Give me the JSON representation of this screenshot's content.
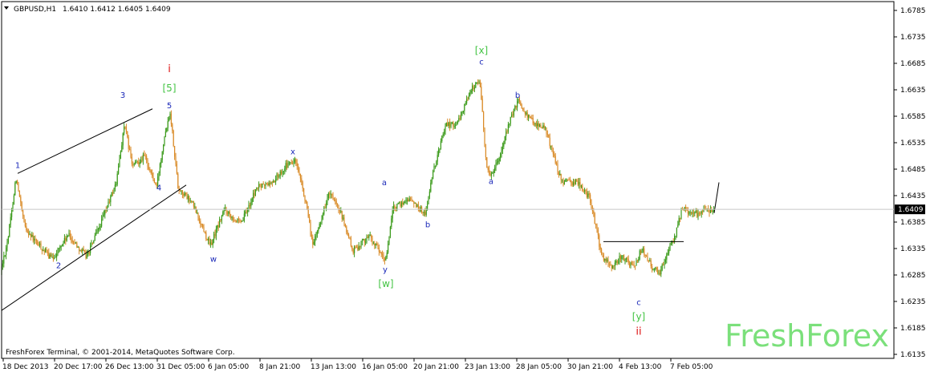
{
  "header": {
    "symbol_label": "GBPUSD,H1",
    "ohlc": "1.6410 1.6412 1.6405 1.6409",
    "menu_arrow": "chevron-down-icon"
  },
  "footer": {
    "copyright": "FreshForex Terminal, © 2001-2014, MetaQuotes Software Corp."
  },
  "watermark": "FreshForex",
  "chart_data": {
    "type": "candlestick",
    "symbol": "GBPUSD",
    "timeframe": "H1",
    "ylim": [
      1.6135,
      1.6785
    ],
    "y_ticks": [
      "1.6785",
      "1.6735",
      "1.6685",
      "1.6635",
      "1.6585",
      "1.6535",
      "1.6485",
      "1.6435",
      "1.6385",
      "1.6335",
      "1.6285",
      "1.6235",
      "1.6185",
      "1.6135"
    ],
    "x_ticks": [
      "18 Dec 2013",
      "20 Dec 17:00",
      "26 Dec 13:00",
      "31 Dec 05:00",
      "6 Jan 05:00",
      "8 Jan 21:00",
      "13 Jan 13:00",
      "16 Jan 05:00",
      "20 Jan 21:00",
      "23 Jan 13:00",
      "28 Jan 05:00",
      "30 Jan 21:00",
      "4 Feb 13:00",
      "7 Feb 05:00"
    ],
    "current_price": "1.6409",
    "grid": false,
    "colors": {
      "bull": "#3a9a1a",
      "bear": "#d98a26",
      "wave_blue": "#1a28b8",
      "wave_green": "#44c444",
      "wave_red": "#dd1111",
      "line": "#000000",
      "watermark": "#7be07b"
    },
    "anchors": [
      [
        0,
        1.6285
      ],
      [
        10,
        1.6355
      ],
      [
        20,
        1.647
      ],
      [
        30,
        1.638
      ],
      [
        40,
        1.6355
      ],
      [
        65,
        1.6315
      ],
      [
        85,
        1.636
      ],
      [
        108,
        1.632
      ],
      [
        125,
        1.638
      ],
      [
        145,
        1.646
      ],
      [
        155,
        1.657
      ],
      [
        165,
        1.649
      ],
      [
        180,
        1.651
      ],
      [
        195,
        1.645
      ],
      [
        205,
        1.655
      ],
      [
        212,
        1.6595
      ],
      [
        222,
        1.645
      ],
      [
        240,
        1.642
      ],
      [
        262,
        1.634
      ],
      [
        280,
        1.641
      ],
      [
        300,
        1.638
      ],
      [
        320,
        1.645
      ],
      [
        340,
        1.646
      ],
      [
        355,
        1.649
      ],
      [
        368,
        1.65
      ],
      [
        380,
        1.643
      ],
      [
        390,
        1.634
      ],
      [
        410,
        1.644
      ],
      [
        425,
        1.64
      ],
      [
        440,
        1.633
      ],
      [
        460,
        1.636
      ],
      [
        480,
        1.631
      ],
      [
        490,
        1.641
      ],
      [
        510,
        1.643
      ],
      [
        530,
        1.64
      ],
      [
        540,
        1.648
      ],
      [
        555,
        1.657
      ],
      [
        570,
        1.657
      ],
      [
        585,
        1.663
      ],
      [
        598,
        1.6655
      ],
      [
        606,
        1.649
      ],
      [
        612,
        1.6475
      ],
      [
        625,
        1.652
      ],
      [
        635,
        1.6575
      ],
      [
        646,
        1.6615
      ],
      [
        660,
        1.658
      ],
      [
        680,
        1.656
      ],
      [
        700,
        1.646
      ],
      [
        720,
        1.646
      ],
      [
        735,
        1.643
      ],
      [
        742,
        1.638
      ],
      [
        750,
        1.632
      ],
      [
        762,
        1.63
      ],
      [
        775,
        1.632
      ],
      [
        790,
        1.63
      ],
      [
        800,
        1.6335
      ],
      [
        812,
        1.63
      ],
      [
        822,
        1.629
      ],
      [
        832,
        1.633
      ],
      [
        840,
        1.635
      ],
      [
        850,
        1.641
      ],
      [
        870,
        1.64
      ],
      [
        890,
        1.6412
      ]
    ],
    "lines": [
      {
        "name": "upper-channel-line",
        "x1": 22,
        "y1": 1.6477,
        "x2": 190,
        "y2": 1.6599
      },
      {
        "name": "lower-channel-line",
        "x1": 2,
        "y1": 1.6218,
        "x2": 232,
        "y2": 1.6455
      },
      {
        "name": "flat-correction-line",
        "x1": 752,
        "y1": 1.6348,
        "x2": 852,
        "y2": 1.6348
      },
      {
        "name": "last-move-line",
        "x1": 890,
        "y1": 1.6402,
        "x2": 896,
        "y2": 1.646
      }
    ],
    "wave_labels": [
      {
        "text": "1",
        "x": 22,
        "y": 1.6487,
        "color": "wave_blue"
      },
      {
        "text": "2",
        "x": 73,
        "y": 1.6298,
        "color": "wave_blue"
      },
      {
        "text": "3",
        "x": 153,
        "y": 1.662,
        "color": "wave_blue"
      },
      {
        "text": "4",
        "x": 198,
        "y": 1.6445,
        "color": "wave_blue"
      },
      {
        "text": "5",
        "x": 211,
        "y": 1.66,
        "color": "wave_blue"
      },
      {
        "text": "[5]",
        "x": 211,
        "y": 1.6632,
        "color": "wave_green"
      },
      {
        "text": "i",
        "x": 211,
        "y": 1.6668,
        "color": "wave_red"
      },
      {
        "text": "w",
        "x": 266,
        "y": 1.631,
        "color": "wave_blue"
      },
      {
        "text": "x",
        "x": 365,
        "y": 1.6513,
        "color": "wave_blue"
      },
      {
        "text": "a",
        "x": 479,
        "y": 1.6455,
        "color": "wave_blue"
      },
      {
        "text": "y",
        "x": 480,
        "y": 1.629,
        "color": "wave_blue"
      },
      {
        "text": "[w]",
        "x": 481,
        "y": 1.6262,
        "color": "wave_green"
      },
      {
        "text": "b",
        "x": 533,
        "y": 1.6375,
        "color": "wave_blue"
      },
      {
        "text": "[x]",
        "x": 600,
        "y": 1.6703,
        "color": "wave_green"
      },
      {
        "text": "c",
        "x": 600,
        "y": 1.6683,
        "color": "wave_blue"
      },
      {
        "text": "a",
        "x": 612,
        "y": 1.6457,
        "color": "wave_blue"
      },
      {
        "text": "b",
        "x": 645,
        "y": 1.662,
        "color": "wave_blue"
      },
      {
        "text": "c",
        "x": 796,
        "y": 1.6228,
        "color": "wave_blue"
      },
      {
        "text": "[y]",
        "x": 796,
        "y": 1.62,
        "color": "wave_green"
      },
      {
        "text": "ii",
        "x": 796,
        "y": 1.6172,
        "color": "wave_red"
      }
    ]
  }
}
